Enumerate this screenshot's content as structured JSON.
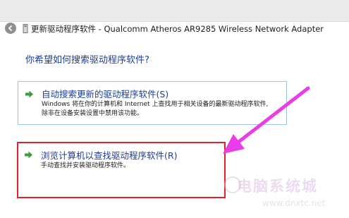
{
  "window": {
    "title": "更新驱动程序软件 - Qualcomm Atheros AR9285 Wireless Network Adapter"
  },
  "main": {
    "question": "你希望如何搜索驱动程序软件?",
    "options": [
      {
        "title": "自动搜索更新的驱动程序软件(S)",
        "description_line1": "Windows 将在你的计算机和 Internet 上查找用于相关设备的最新驱动程序软件,",
        "description_line2": "除非在设备安装设置中禁用该功能。"
      },
      {
        "title": "浏览计算机以查找驱动程序软件(R)",
        "description_line1": "手动查找并安装驱动程序软件。"
      }
    ]
  },
  "watermark": {
    "site_name": "电脑系统城",
    "url": "www.dnxtc.net"
  },
  "icons": {
    "back": "back-arrow-icon",
    "device": "device-adapter-icon",
    "option_arrow": "green-arrow-icon"
  },
  "colors": {
    "link_blue": "#1c3f95",
    "option_border": "#9cc3e8",
    "annotation_red": "#e2232f",
    "annotation_magenta": "#e93ee6",
    "arrow_green": "#3a9c3a"
  }
}
